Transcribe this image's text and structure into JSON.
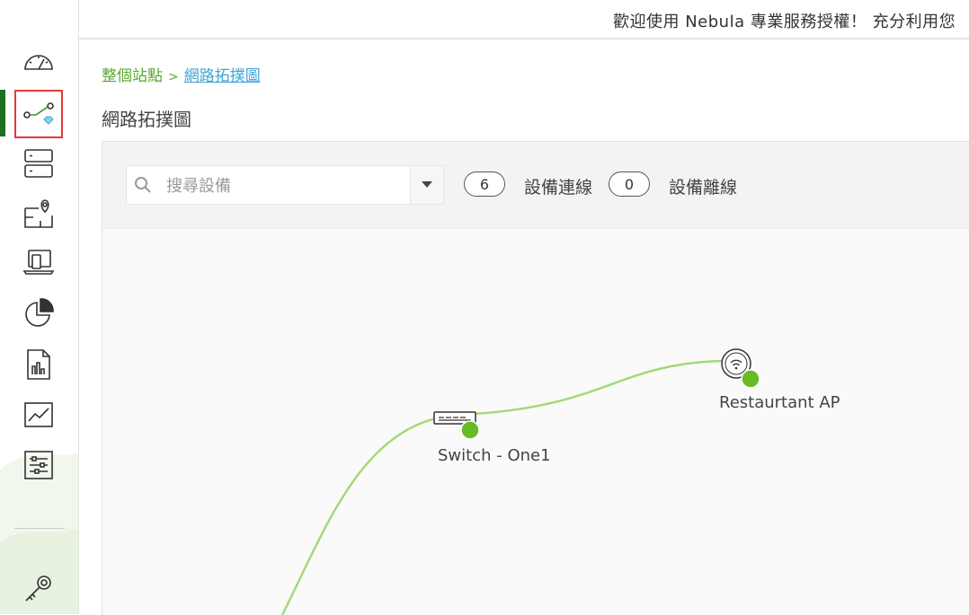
{
  "topbar": {
    "message": "歡迎使用 Nebula 專業服務授權！ 充分利用您"
  },
  "breadcrumb": {
    "root": "整個站點",
    "separator": ">",
    "current": "網路拓撲圖"
  },
  "page_title": "網路拓撲圖",
  "toolbar": {
    "search_placeholder": "搜尋設備",
    "online_count": "6",
    "online_label": "設備連線",
    "offline_count": "0",
    "offline_label": "設備離線"
  },
  "sidebar": {
    "items": [
      {
        "icon": "dashboard-icon"
      },
      {
        "icon": "topology-icon",
        "active": true
      },
      {
        "icon": "devices-icon"
      },
      {
        "icon": "site-map-icon"
      },
      {
        "icon": "clients-icon"
      },
      {
        "icon": "pie-chart-icon"
      },
      {
        "icon": "report-icon"
      },
      {
        "icon": "line-chart-icon"
      },
      {
        "icon": "settings-sliders-icon"
      }
    ],
    "bottom_icon": "license-key-icon"
  },
  "topology": {
    "nodes": [
      {
        "name": "Switch - One1",
        "type": "switch",
        "status": "online"
      },
      {
        "name": "Restaurtant AP",
        "type": "access-point",
        "status": "online"
      }
    ]
  },
  "colors": {
    "accent_green": "#5aa832",
    "link_blue": "#41a4d8",
    "status_online": "#66bb22",
    "link_line": "#a3d977",
    "active_bar": "#1e6f1e",
    "highlight_border": "#e53935"
  }
}
